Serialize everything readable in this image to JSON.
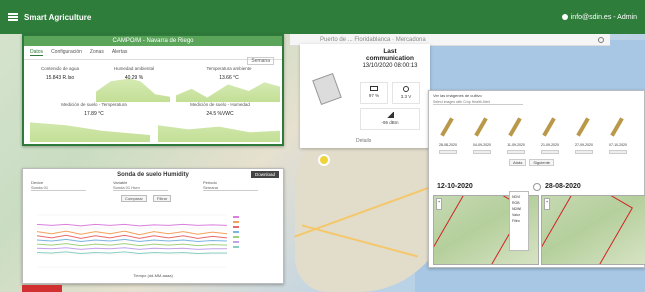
{
  "topbar": {
    "title": "Smart Agriculture",
    "user": "info@sdin.es - Admin"
  },
  "map": {
    "search_text": "Puerto de ... Floridablanca · Mercadona"
  },
  "sensor_panel": {
    "title": "CAMPO/M - Navarra de Riego",
    "header_right": "",
    "tabs": [
      "Datos",
      "Configuración",
      "Zonas",
      "Alertas"
    ],
    "active_tab": 0,
    "period": "Semana",
    "metrics": [
      {
        "label": "Contenido de agua",
        "value": "15.843 R.Iso"
      },
      {
        "label": "Humedad ambiental",
        "value": "40.29 %"
      },
      {
        "label": "Temperatura ambiente",
        "value": "13.66 °C"
      },
      {
        "label": "Medición de suelo - Temperatura",
        "value": "17.89 °C"
      },
      {
        "label": "Medición de suelo - Humedad",
        "value": "24.5 %VWC"
      }
    ]
  },
  "device": {
    "last_comm_label": "Last communication",
    "last_comm_value": "13/10/2020 08:00:13",
    "battery": "97 %",
    "voltage": "3.3 V",
    "signal": "-95 dBm",
    "details_label": "Details"
  },
  "chart_panel": {
    "title": "Sonda de suelo Humidity",
    "download_label": "Download",
    "filter_labels": [
      "Device",
      "Variable",
      "Periodo"
    ],
    "filter_values": [
      "Sonda 01",
      "Sonda 01 Hum",
      "Semana"
    ],
    "buttons": [
      "Comparar",
      "Filtrar"
    ],
    "x_label": "Tiempo (dd-MM-aaaa)",
    "colors": [
      "#d97fdc",
      "#f3a15b",
      "#e86a6a",
      "#7ab6e0",
      "#9fd07a",
      "#c4a1e8",
      "#89cfc1"
    ]
  },
  "chart_data": {
    "type": "line",
    "title": "Sonda de suelo Humidity",
    "xlabel": "Tiempo (dd-MM-aaaa)",
    "ylabel": "",
    "ylim": [
      0,
      100
    ],
    "x": [
      1,
      2,
      3,
      4,
      5,
      6,
      7,
      8,
      9,
      10,
      11,
      12,
      13,
      14
    ],
    "series": [
      {
        "values": [
          82,
          80,
          82,
          79,
          82,
          80,
          82,
          79,
          81,
          80,
          82,
          80,
          81,
          80
        ]
      },
      {
        "values": [
          68,
          64,
          69,
          63,
          68,
          64,
          69,
          62,
          68,
          64,
          68,
          63,
          67,
          64
        ]
      },
      {
        "values": [
          60,
          56,
          61,
          55,
          60,
          56,
          61,
          55,
          60,
          56,
          60,
          55,
          59,
          56
        ]
      },
      {
        "values": [
          52,
          50,
          53,
          49,
          52,
          50,
          53,
          49,
          52,
          50,
          52,
          49,
          51,
          50
        ]
      },
      {
        "values": [
          44,
          42,
          45,
          41,
          44,
          42,
          45,
          41,
          44,
          42,
          44,
          41,
          43,
          42
        ]
      },
      {
        "values": [
          36,
          35,
          37,
          34,
          36,
          35,
          37,
          34,
          36,
          35,
          36,
          34,
          35,
          35
        ]
      },
      {
        "values": [
          28,
          27,
          29,
          26,
          28,
          27,
          29,
          26,
          28,
          27,
          28,
          26,
          27,
          27
        ]
      }
    ]
  },
  "image_panel": {
    "title": "Ver las imágenes de cultivo",
    "subtitle": "Select images with Crop Health Alert",
    "thumb_dates": [
      "28-08-2020",
      "04-09-2020",
      "11-09-2020",
      "21-09-2020",
      "27-09-2020",
      "07-10-2020"
    ],
    "pager": [
      "Atrás",
      "Siguiente"
    ],
    "big_left": "12-10-2020",
    "big_right": "28-08-2020",
    "layers": [
      "NDVI",
      "RGB",
      "NDWI",
      "Valor",
      "Filtro"
    ]
  }
}
